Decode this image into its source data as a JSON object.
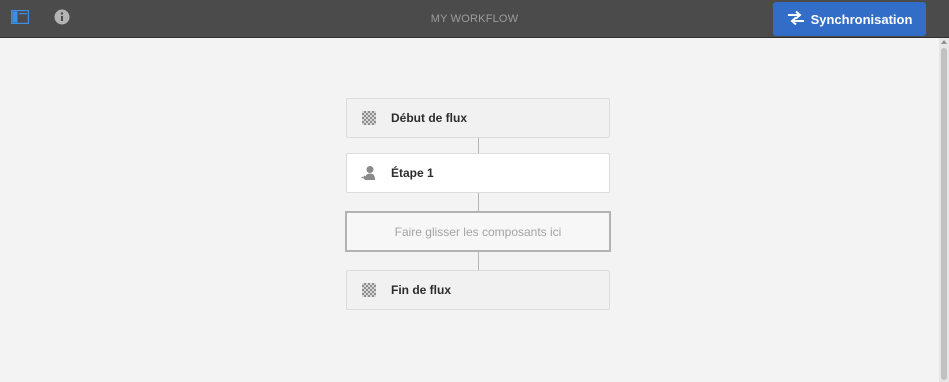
{
  "header": {
    "title": "MY WORKFLOW",
    "sidepanel_icon": "side-panel-icon",
    "info_icon": "info-icon",
    "sync": {
      "label": "Synchronisation",
      "icon": "sync-arrows-icon",
      "color": "#326ec8"
    }
  },
  "workflow": {
    "start": {
      "label": "Début de flux",
      "icon": "flow-start-checker-icon"
    },
    "step1": {
      "label": "Étape 1",
      "icon": "participant-step-icon"
    },
    "dropzone": {
      "label": "Faire glisser les composants ici"
    },
    "end": {
      "label": "Fin de flux",
      "icon": "flow-end-checker-icon"
    }
  }
}
